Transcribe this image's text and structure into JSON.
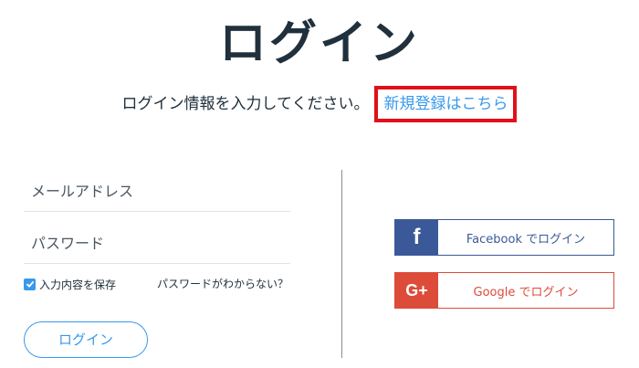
{
  "header": {
    "title": "ログイン",
    "subtitle": "ログイン情報を入力してください。",
    "signup_link": "新規登録はこちら"
  },
  "form": {
    "email_placeholder": "メールアドレス",
    "password_placeholder": "パスワード",
    "remember_label": "入力内容を保存",
    "remember_checked": true,
    "forgot_link": "パスワードがわからない？",
    "login_button": "ログイン"
  },
  "social": {
    "facebook": {
      "icon": "f",
      "label": "Facebook でログイン"
    },
    "google": {
      "icon": "G+",
      "label": "Google でログイン"
    }
  },
  "colors": {
    "accent": "#3899ec",
    "text": "#20303c",
    "facebook": "#3b5998",
    "google": "#dd4b39",
    "highlight_border": "#e0101a"
  }
}
